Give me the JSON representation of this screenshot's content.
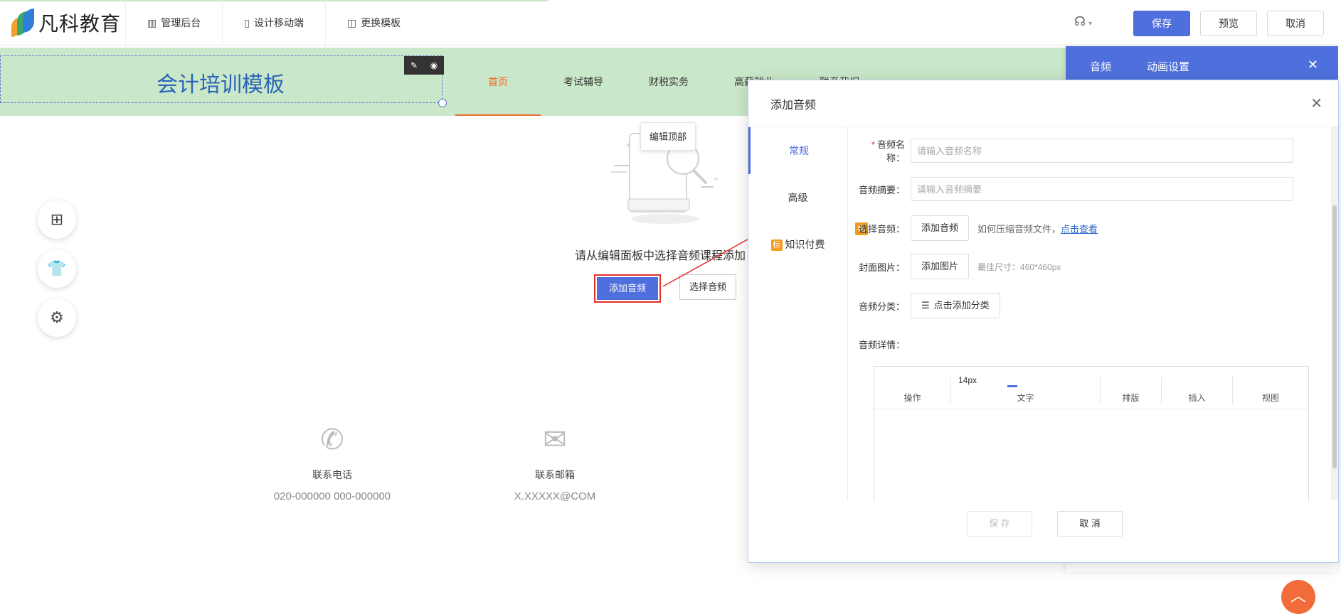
{
  "app": {
    "logo_text": "凡科教育",
    "nav": [
      {
        "label": "管理后台",
        "icon": "chart-icon"
      },
      {
        "label": "设计移动端",
        "icon": "mobile-icon"
      },
      {
        "label": "更换模板",
        "icon": "template-icon"
      }
    ],
    "buttons": {
      "save": "保存",
      "preview": "预览",
      "cancel": "取消"
    }
  },
  "site": {
    "title": "会计培训模板",
    "nav": [
      "首页",
      "考试辅导",
      "财税实务",
      "高薪就业",
      "联系我们"
    ],
    "active_nav": "首页"
  },
  "canvas": {
    "tooltip": "编辑顶部",
    "empty_message": "请从编辑面板中选择音频课程添加",
    "add_audio": "添加音频",
    "select_audio": "选择音频"
  },
  "contacts": [
    {
      "label": "联系电话",
      "value": "020-000000 000-000000",
      "icon": "phone-icon"
    },
    {
      "label": "联系邮箱",
      "value": "X.XXXXX@COM",
      "icon": "mail-icon"
    }
  ],
  "side_panel": {
    "tabs": [
      "音频",
      "动画设置"
    ]
  },
  "modal": {
    "title": "添加音频",
    "tabs": [
      "常规",
      "高级",
      "知识付费"
    ],
    "active_tab": "常规",
    "badge": "标",
    "fields": {
      "name_label": "音频名称：",
      "name_placeholder": "请输入音频名称",
      "summary_label": "音频摘要：",
      "summary_placeholder": "请输入音频摘要",
      "select_label": "选择音频：",
      "select_button": "添加音频",
      "select_hint": "如何压缩音频文件，",
      "select_link": "点击查看",
      "cover_label": "封面图片：",
      "cover_button": "添加图片",
      "cover_hint": "最佳尺寸：460*460px",
      "category_label": "音频分类：",
      "category_button": "点击添加分类",
      "detail_label": "音频详情："
    },
    "editor": {
      "font_size": "14px",
      "groups": [
        "操作",
        "文字",
        "排版",
        "插入",
        "视图"
      ]
    },
    "footer": {
      "save": "保 存",
      "cancel": "取 消"
    }
  },
  "colors": {
    "primary": "#4f6fdc",
    "accent": "#ef6b30",
    "band": "#c9e7c9",
    "title": "#2a64b8",
    "badge": "#f39b1e"
  }
}
